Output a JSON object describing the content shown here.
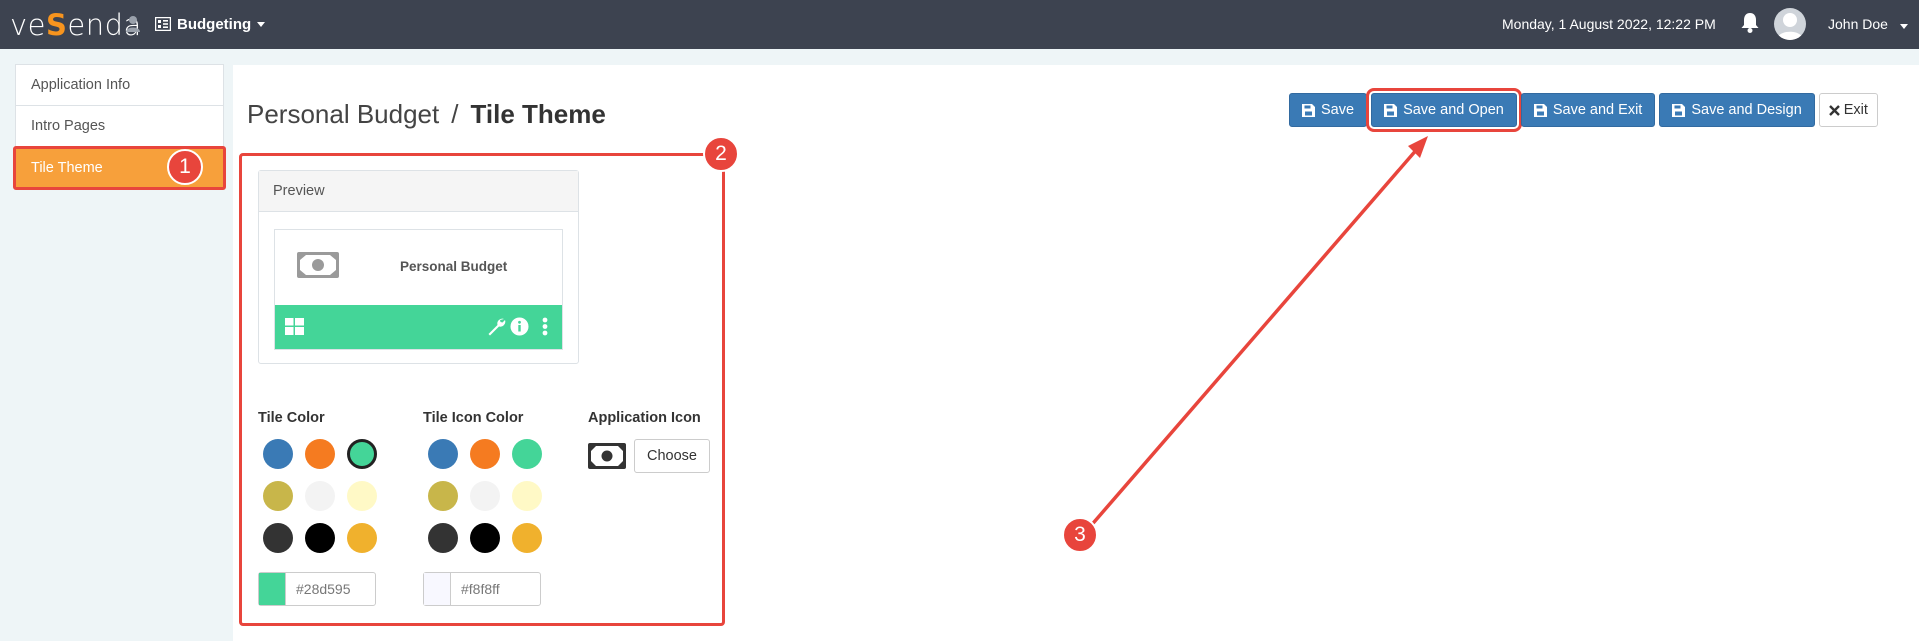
{
  "navbar": {
    "logo_pre": "ve",
    "logo_mid": "S",
    "logo_post": "enda",
    "app_name": "Budgeting",
    "datetime": "Monday, 1 August 2022, 12:22 PM",
    "user_name": "John Doe"
  },
  "sidebar": {
    "items": [
      {
        "label": "Application Info"
      },
      {
        "label": "Intro Pages"
      },
      {
        "label": "Tile Theme"
      }
    ]
  },
  "breadcrumb": {
    "parent": "Personal Budget",
    "separator": "/",
    "current": "Tile Theme"
  },
  "toolbar": {
    "save": "Save",
    "save_open": "Save and Open",
    "save_exit": "Save and Exit",
    "save_design": "Save and Design",
    "exit": "Exit"
  },
  "preview": {
    "heading": "Preview",
    "tile_title": "Personal Budget",
    "tile_color": "#44d598"
  },
  "tile_color": {
    "label": "Tile Color",
    "swatches": [
      "#3a7ab5",
      "#f57b20",
      "#44d598",
      "#c8b64a",
      "#f3f3f3",
      "#fff9c6",
      "#333333",
      "#000000",
      "#f0b12d"
    ],
    "selected": "#44d598",
    "value": "#28d595"
  },
  "tile_icon_color": {
    "label": "Tile Icon Color",
    "swatches": [
      "#3a7ab5",
      "#f57b20",
      "#44d598",
      "#c8b64a",
      "#f3f3f3",
      "#fff9c6",
      "#333333",
      "#000000",
      "#f0b12d"
    ],
    "value": "#f8f8ff"
  },
  "application_icon": {
    "label": "Application Icon",
    "icon": "money-bill-icon",
    "choose": "Choose"
  },
  "annotations": {
    "badge_1": "1",
    "badge_2": "2",
    "badge_3": "3",
    "color": "#e8453c"
  }
}
